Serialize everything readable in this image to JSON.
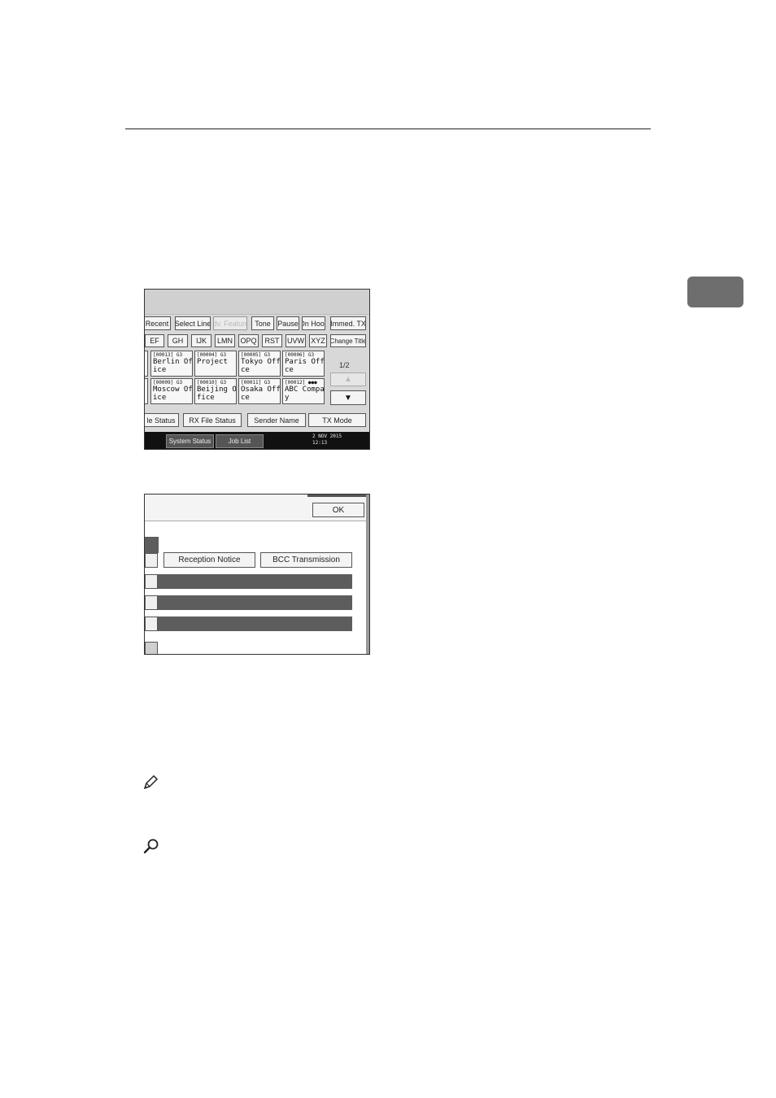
{
  "screen1": {
    "row1": [
      "Recent",
      "Select Line",
      "Adv. Features",
      "Tone",
      "Pause",
      "On Hook",
      "Immed. TX"
    ],
    "row2": [
      "EF",
      "GH",
      "IJK",
      "LMN",
      "OPQ",
      "RST",
      "UVW",
      "XYZ",
      "Change Title"
    ],
    "destinations": [
      {
        "num": "[00013] G3",
        "line1": "Berlin Off",
        "line2": "ice"
      },
      {
        "num": "[00004] G3",
        "line1": "Project",
        "line2": ""
      },
      {
        "num": "[00005] G3",
        "line1": "Tokyo Offi",
        "line2": "ce"
      },
      {
        "num": "[00006] G3",
        "line1": "Paris Offi",
        "line2": "ce"
      },
      {
        "num": "[00009] G3",
        "line1": "Moscow Off",
        "line2": "ice"
      },
      {
        "num": "[00010] G3",
        "line1": "Beijing Of",
        "line2": "fice"
      },
      {
        "num": "[00011] G3",
        "line1": "Osaka Offi",
        "line2": "ce"
      },
      {
        "num": "[00012]",
        "line1": "ABC Compan",
        "line2": "y"
      }
    ],
    "page_indicator": "1/2",
    "up_arrow": "▲",
    "down_arrow": "▼",
    "bottom_row": [
      "le Status",
      "RX File Status",
      "Sender Name",
      "TX Mode"
    ],
    "tabs": [
      "System Status",
      "Job List"
    ],
    "clock_date": "2 NOV  2015",
    "clock_time": "12:13"
  },
  "screen2": {
    "ok_label": "OK",
    "reception_notice": "Reception Notice",
    "bcc_transmission": "BCC Transmission"
  }
}
